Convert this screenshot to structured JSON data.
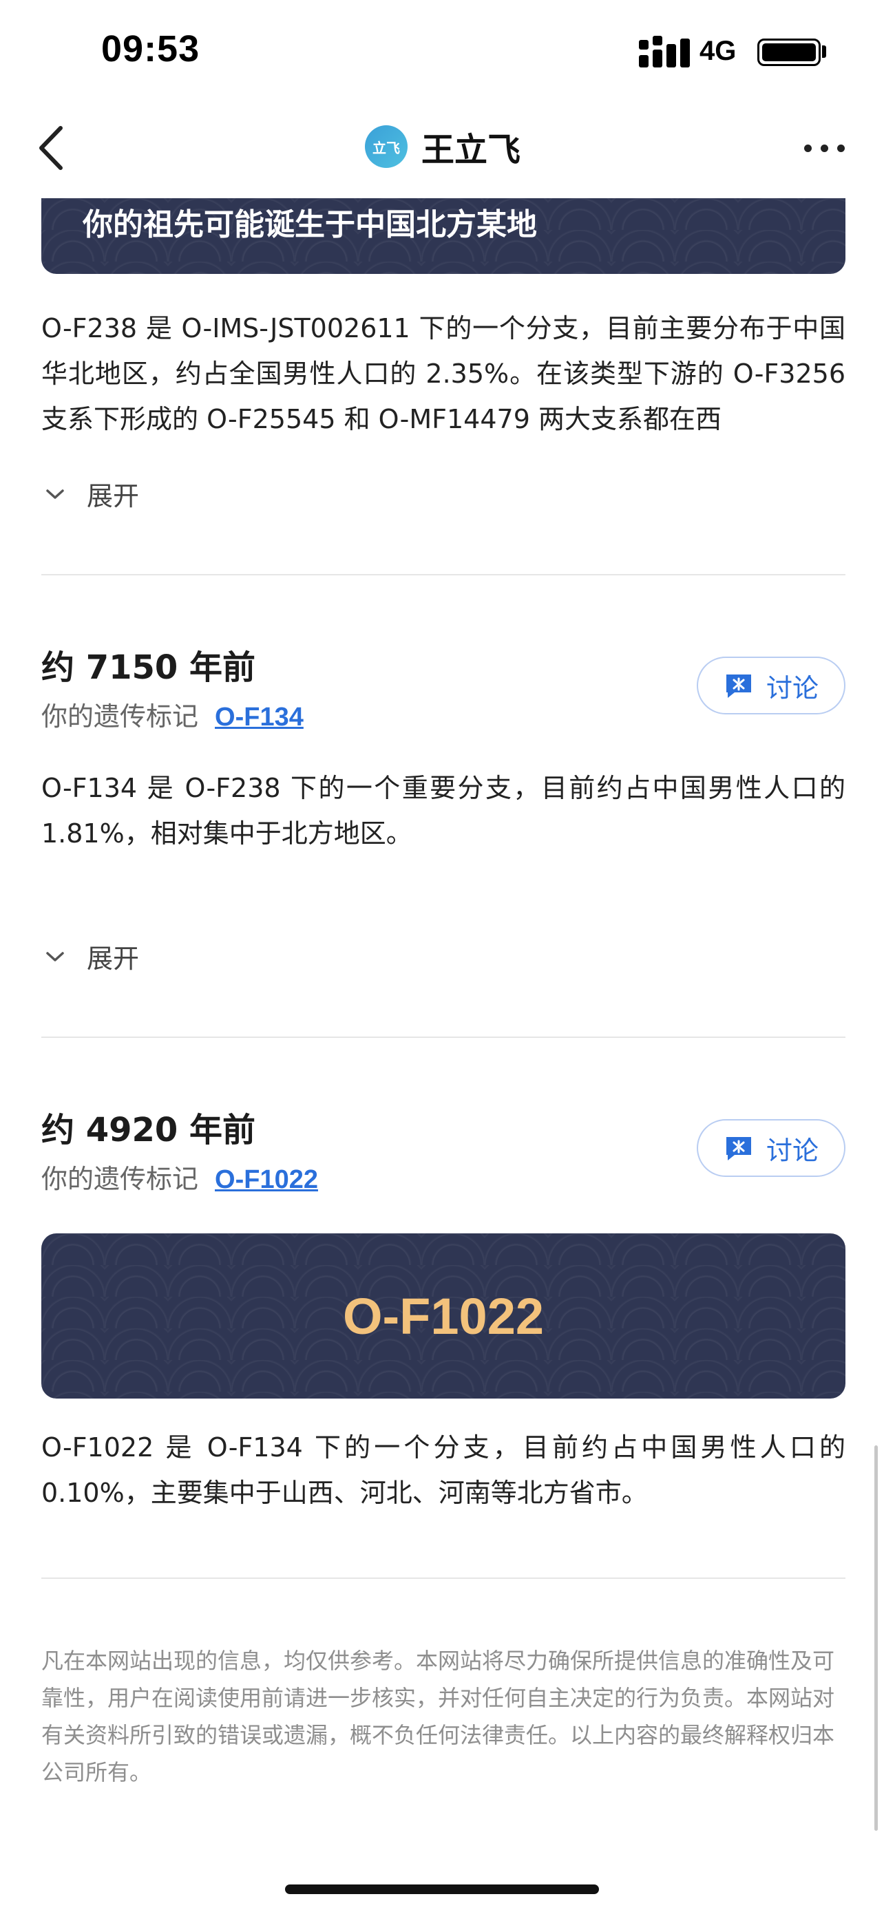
{
  "status_bar": {
    "time": "09:53",
    "network": "4G"
  },
  "nav": {
    "avatar_text": "立飞",
    "title": "王立飞"
  },
  "top_banner": {
    "text": "你的祖先可能诞生于中国北方某地"
  },
  "section0": {
    "paragraph": "O-F238 是 O-IMS-JST002611 下的一个分支，目前主要分布于中国华北地区，约占全国男性人口的 2.35%。在该类型下游的 O-F3256 支系下形成的 O-F25545 和 O-MF14479 两大支系都在西",
    "expand_label": "展开"
  },
  "section1": {
    "title": "约 7150 年前",
    "marker_label": "你的遗传标记",
    "marker_link": "O-F134",
    "discuss_label": "讨论",
    "paragraph": "O-F134 是 O-F238 下的一个重要分支，目前约占中国男性人口的 1.81%，相对集中于北方地区。",
    "expand_label": "展开"
  },
  "section2": {
    "title": "约 4920 年前",
    "marker_label": "你的遗传标记",
    "marker_link": "O-F1022",
    "discuss_label": "讨论",
    "banner_text": "O-F1022",
    "paragraph": "O-F1022 是 O-F134 下的一个分支，目前约占中国男性人口的 0.10%，主要集中于山西、河北、河南等北方省市。"
  },
  "disclaimer": "凡在本网站出现的信息，均仅供参考。本网站将尽力确保所提供信息的准确性及可靠性，用户在阅读使用前请进一步核实，并对任何自主决定的行为负责。本网站对有关资料所引致的错误或遗漏，概不负任何法律责任。以上内容的最终解释权归本公司所有。",
  "colors": {
    "accent": "#2a6fdb",
    "banner_bg": "#2f3653",
    "banner_gold": "#f3c27c"
  },
  "icons": [
    "signal-icon",
    "battery-icon",
    "back-arrow-icon",
    "more-icon",
    "chevron-down-icon",
    "discuss-icon"
  ]
}
